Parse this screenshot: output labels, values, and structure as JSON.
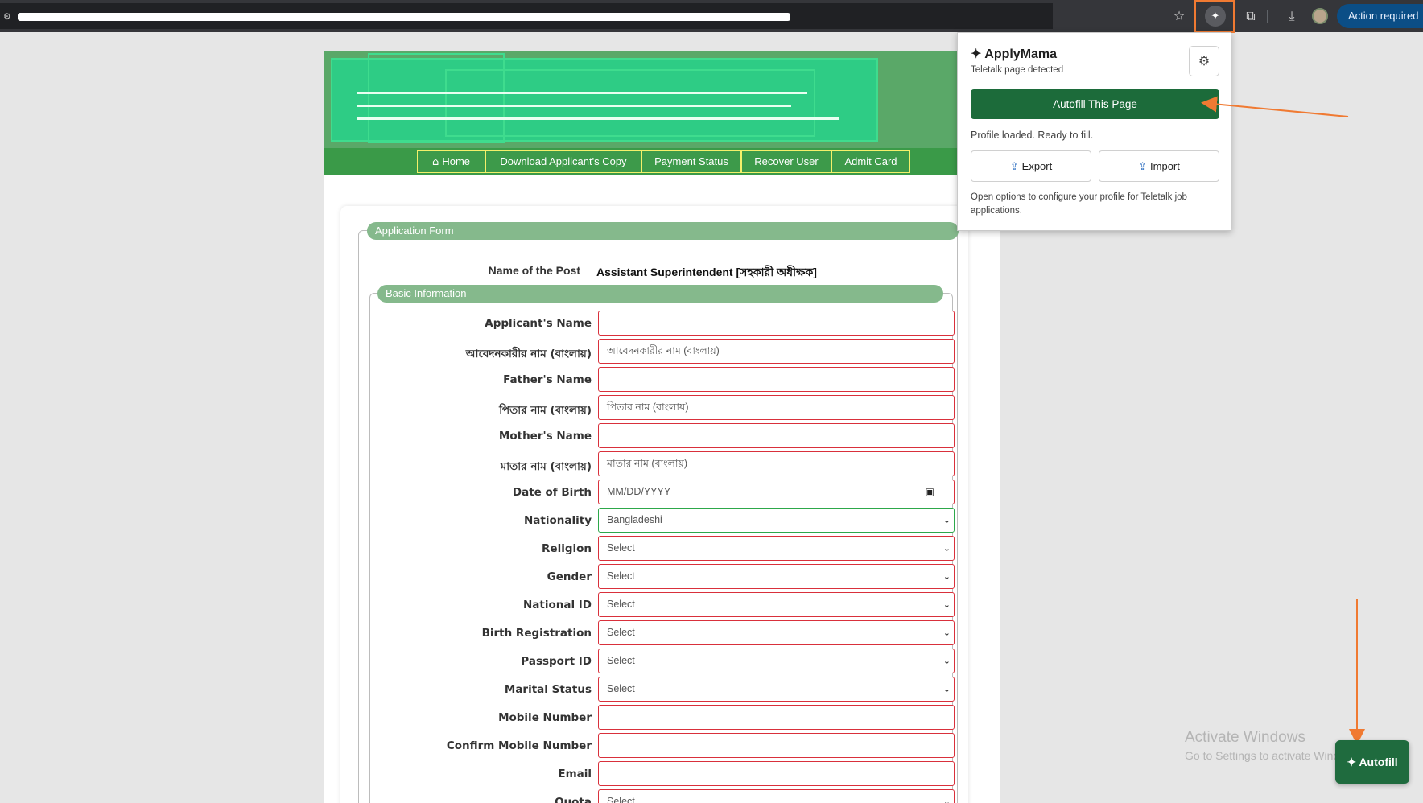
{
  "browser": {
    "action_required": "Action required"
  },
  "nav": {
    "items": [
      "Home",
      "Download Applicant's Copy",
      "Payment Status",
      "Recover User",
      "Admit Card"
    ]
  },
  "form": {
    "legend": "Application Form",
    "post_label": "Name of the Post",
    "post_value": "Assistant Superintendent [সহকারী অধীক্ষক]",
    "basic_legend": "Basic Information",
    "fields": [
      {
        "label": "Applicant's Name",
        "value": ""
      },
      {
        "label": "আবেদনকারীর নাম (বাংলায়)",
        "value": "আবেদনকারীর নাম (বাংলায়)"
      },
      {
        "label": "Father's Name",
        "value": ""
      },
      {
        "label": "পিতার নাম (বাংলায়)",
        "value": "পিতার নাম (বাংলায়)"
      },
      {
        "label": "Mother's Name",
        "value": ""
      },
      {
        "label": "মাতার নাম (বাংলায়)",
        "value": "মাতার নাম (বাংলায়)"
      },
      {
        "label": "Date of Birth",
        "value": "MM/DD/YYYY"
      },
      {
        "label": "Nationality",
        "value": "Bangladeshi"
      },
      {
        "label": "Religion",
        "value": "Select"
      },
      {
        "label": "Gender",
        "value": "Select"
      },
      {
        "label": "National ID",
        "value": "Select"
      },
      {
        "label": "Birth Registration",
        "value": "Select"
      },
      {
        "label": "Passport ID",
        "value": "Select"
      },
      {
        "label": "Marital Status",
        "value": "Select"
      },
      {
        "label": "Mobile Number",
        "value": ""
      },
      {
        "label": "Confirm Mobile Number",
        "value": ""
      },
      {
        "label": "Email",
        "value": ""
      },
      {
        "label": "Quota",
        "value": "Select"
      }
    ]
  },
  "popup": {
    "title": "✦ ApplyMama",
    "subtitle": "Teletalk page detected",
    "autofill_label": "Autofill This Page",
    "status": "Profile loaded. Ready to fill.",
    "export_label": "Export",
    "import_label": "Import",
    "note": "Open options to configure your profile for Teletalk job applications."
  },
  "watermark": {
    "line1": "Activate Windows",
    "line2": "Go to Settings to activate Windows."
  },
  "floating_button": "✦ Autofill",
  "colors": {
    "accent_green": "#1c6b3a",
    "arrow_orange": "#f07a32",
    "header_green": "#3a9a48"
  }
}
